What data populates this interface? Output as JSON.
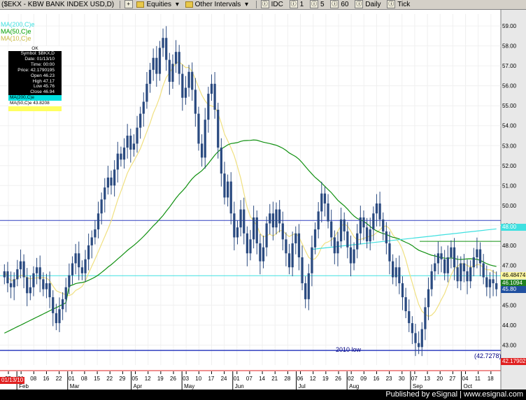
{
  "toolbar": {
    "symbol": "($EKX - KBW BANK INDEX USD,D)",
    "items": [
      {
        "icon": "folder-icon",
        "label": "Equities",
        "arrow": "▾"
      },
      {
        "icon": "folder-icon",
        "label": "Other Intervals",
        "arrow": "▾"
      },
      {
        "icon": "circle-i",
        "label": "IDC"
      },
      {
        "icon": "circle-i",
        "label": "1"
      },
      {
        "icon": "circle-i",
        "label": "5"
      },
      {
        "icon": "circle-i",
        "label": "60"
      },
      {
        "icon": "circle-i",
        "label": "Daily"
      },
      {
        "icon": "circle-i",
        "label": "Tick"
      }
    ]
  },
  "legend": [
    {
      "text": "MA(200,C)e",
      "color": "#40e0e0"
    },
    {
      "text": "MA(50,C)e",
      "color": "#00c000"
    },
    {
      "text": "MA(10,C)e",
      "color": "#f0e080"
    }
  ],
  "databox": {
    "header": "OK",
    "rows": [
      "Symbol: $BKX,D",
      "Date: 01/13/10",
      "Time: 00:00",
      "Price: 42.1790195",
      "Open 46.23",
      "High 47.17",
      "Low 45.76",
      "Close 46.94"
    ],
    "ma200": "MA(200,C)e",
    "ma50": "MA(50,C)e 43.8208",
    "ma10": ""
  },
  "annotations": {
    "low_label": "2010 low",
    "low_value": "(42.7278)"
  },
  "price_tags": [
    {
      "value": "48.00",
      "bg": "#40e0e0",
      "fg": "#ffffff",
      "price": 48.9
    },
    {
      "value": "46.48474",
      "bg": "#fff8a0",
      "fg": "#000000",
      "price": 46.48
    },
    {
      "value": "46.1094",
      "bg": "#208020",
      "fg": "#ffffff",
      "price": 46.11
    },
    {
      "value": "45.80",
      "bg": "#2050a0",
      "fg": "#ffffff",
      "price": 45.8
    },
    {
      "value": "42.17902",
      "bg": "#e02020",
      "fg": "#ffffff",
      "price": 42.18
    }
  ],
  "date_tag": "01/13/10",
  "footer": {
    "text": "Published by eSignal | www.esignal.com"
  },
  "colors": {
    "bg": "#ffffff",
    "candle": "#2a4a80",
    "ma50": "#109010",
    "ma10": "#f0e080",
    "ma200": "#40e0e0",
    "hline_blue": "#3040c0",
    "hline_green": "#109010"
  },
  "chart_data": {
    "type": "candlestick",
    "y_ticks": [
      43.0,
      44.0,
      45.0,
      46.0,
      47.0,
      48.0,
      49.0,
      50.0,
      51.0,
      52.0,
      53.0,
      54.0,
      55.0,
      56.0,
      57.0,
      58.0,
      59.0
    ],
    "ylim": [
      42.0,
      59.6
    ],
    "x_day_labels": [
      "25",
      "01",
      "08",
      "16",
      "22",
      "01",
      "08",
      "15",
      "22",
      "29",
      "05",
      "12",
      "19",
      "26",
      "03",
      "10",
      "17",
      "24",
      "01",
      "07",
      "14",
      "21",
      "28",
      "06",
      "12",
      "19",
      "26",
      "02",
      "09",
      "16",
      "23",
      "30",
      "07",
      "13",
      "20",
      "27",
      "04",
      "11",
      "18"
    ],
    "x_month_labels": [
      {
        "label": "Feb",
        "after_day_index": 1
      },
      {
        "label": "Mar",
        "after_day_index": 5
      },
      {
        "label": "Apr",
        "after_day_index": 10
      },
      {
        "label": "May",
        "after_day_index": 14
      },
      {
        "label": "Jun",
        "after_day_index": 18
      },
      {
        "label": "Jul",
        "after_day_index": 23
      },
      {
        "label": "Aug",
        "after_day_index": 27
      },
      {
        "label": "Sep",
        "after_day_index": 32
      },
      {
        "label": "Oct",
        "after_day_index": 36
      }
    ],
    "closes": [
      46.7,
      46.1,
      45.9,
      46.3,
      46.8,
      47.2,
      46.4,
      45.6,
      45.9,
      46.6,
      46.9,
      46.3,
      45.8,
      46.1,
      45.4,
      44.6,
      44.1,
      44.8,
      45.3,
      45.9,
      46.5,
      47.1,
      47.6,
      46.9,
      46.6,
      47.3,
      48.0,
      48.4,
      48.8,
      49.6,
      50.3,
      50.9,
      51.4,
      51.0,
      51.8,
      52.6,
      52.3,
      52.9,
      53.5,
      52.8,
      53.1,
      53.9,
      54.6,
      55.2,
      56.1,
      56.8,
      57.4,
      56.6,
      57.9,
      58.4,
      57.3,
      56.2,
      57.1,
      57.7,
      56.6,
      55.4,
      55.9,
      56.7,
      55.8,
      54.6,
      53.1,
      52.4,
      54.3,
      55.6,
      56.1,
      54.8,
      52.9,
      51.6,
      50.4,
      51.2,
      49.6,
      48.4,
      48.9,
      49.8,
      48.6,
      47.6,
      48.3,
      49.4,
      48.1,
      47.2,
      47.9,
      49.1,
      49.6,
      48.9,
      49.8,
      49.1,
      48.3,
      47.6,
      46.9,
      48.1,
      48.6,
      47.4,
      46.1,
      45.3,
      46.6,
      47.9,
      48.8,
      49.7,
      50.6,
      50.1,
      49.2,
      48.4,
      47.6,
      48.2,
      49.3,
      48.7,
      47.9,
      47.1,
      47.8,
      48.6,
      49.4,
      48.9,
      48.2,
      48.8,
      49.6,
      50.1,
      49.3,
      48.7,
      48.1,
      47.2,
      46.4,
      46.9,
      46.1,
      45.4,
      44.7,
      44.1,
      43.6,
      43.1,
      42.9,
      43.8,
      44.9,
      45.8,
      46.7,
      47.1,
      47.6,
      47.3,
      46.6,
      47.4,
      47.9,
      46.9,
      46.2,
      47.1,
      46.7,
      46.2,
      46.9,
      47.4,
      47.8,
      47.1,
      46.4,
      45.9,
      46.3,
      46.1,
      45.8
    ]
  }
}
